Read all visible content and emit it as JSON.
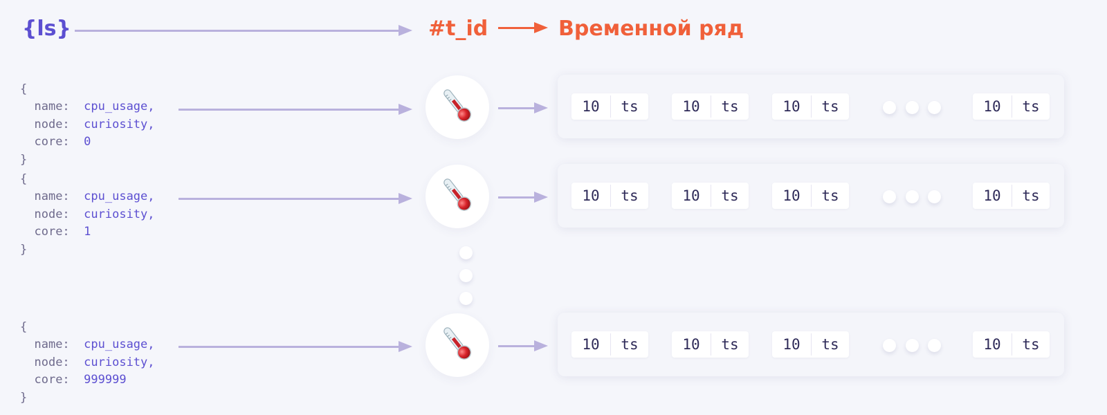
{
  "header": {
    "label_ls": "{ls}",
    "label_tid": "#t_id",
    "label_timeseries": "Временной ряд"
  },
  "colors": {
    "background": "#f5f6fb",
    "purple": "#5c4fd1",
    "orange": "#f0603a",
    "arrow_lavender": "#b9b1dd",
    "text_dark": "#2e2a58"
  },
  "series": [
    {
      "label_set": {
        "open": "{",
        "close": "}",
        "fields": [
          {
            "key": "name:",
            "value": "cpu_usage,"
          },
          {
            "key": "node:",
            "value": "curiosity,"
          },
          {
            "key": "core:",
            "value": "0"
          }
        ]
      },
      "icon": "thermometer-icon",
      "points": [
        {
          "value": "10",
          "ts": "ts"
        },
        {
          "value": "10",
          "ts": "ts"
        },
        {
          "value": "10",
          "ts": "ts"
        },
        {
          "value": "10",
          "ts": "ts"
        }
      ]
    },
    {
      "label_set": {
        "open": "{",
        "close": "}",
        "fields": [
          {
            "key": "name:",
            "value": "cpu_usage,"
          },
          {
            "key": "node:",
            "value": "curiosity,"
          },
          {
            "key": "core:",
            "value": "1"
          }
        ]
      },
      "icon": "thermometer-icon",
      "points": [
        {
          "value": "10",
          "ts": "ts"
        },
        {
          "value": "10",
          "ts": "ts"
        },
        {
          "value": "10",
          "ts": "ts"
        },
        {
          "value": "10",
          "ts": "ts"
        }
      ]
    },
    {
      "label_set": {
        "open": "{",
        "close": "}",
        "fields": [
          {
            "key": "name:",
            "value": "cpu_usage,"
          },
          {
            "key": "node:",
            "value": "curiosity,"
          },
          {
            "key": "core:",
            "value": "999999"
          }
        ]
      },
      "icon": "thermometer-icon",
      "points": [
        {
          "value": "10",
          "ts": "ts"
        },
        {
          "value": "10",
          "ts": "ts"
        },
        {
          "value": "10",
          "ts": "ts"
        },
        {
          "value": "10",
          "ts": "ts"
        }
      ]
    }
  ],
  "ellipsis": {
    "horizontal_dots": 3,
    "vertical_dots": 3
  }
}
